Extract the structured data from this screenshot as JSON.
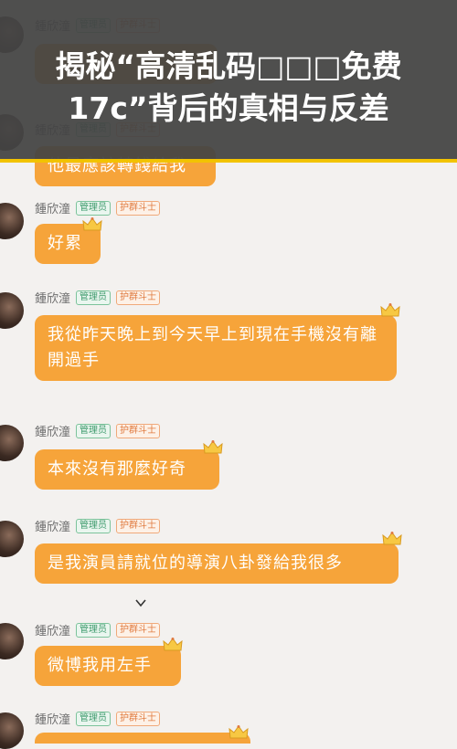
{
  "overlay": {
    "title": "揭秘“高清乱码□□□免费17c”背后的真相与反差"
  },
  "user": {
    "name": "鍾欣潼",
    "role_badge": "管理员",
    "title_badge": "护群斗士"
  },
  "messages": [
    {
      "text": ""
    },
    {
      "text": "他最應該轉錢給我"
    },
    {
      "text": "好累"
    },
    {
      "text": "我從昨天晚上到今天早上到現在手機沒有離開過手"
    },
    {
      "text": "本來沒有那麼好奇"
    },
    {
      "text": "是我演員請就位的導演八卦發給我很多"
    },
    {
      "text": "微博我用左手"
    },
    {
      "text": ""
    }
  ],
  "colors": {
    "bubble": "#f6a43a",
    "overlay": "#444444",
    "overlay_border": "#f2c300",
    "admin_badge": "#3e9a6c",
    "guard_badge": "#e07a3f"
  },
  "icons": {
    "crown": "crown-icon",
    "avatar": "avatar"
  }
}
